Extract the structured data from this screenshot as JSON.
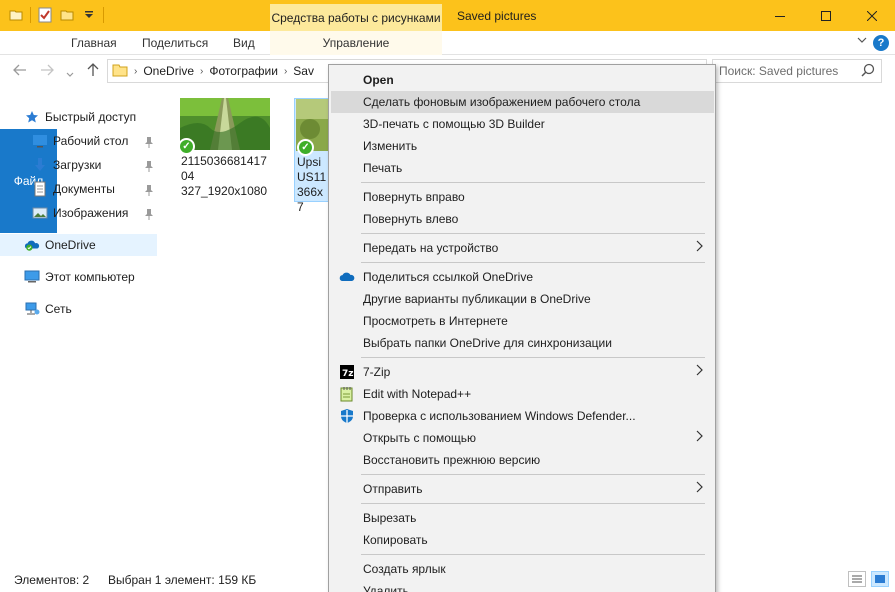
{
  "titlebar": {
    "context_tab_group": "Средства работы с рисунками",
    "window_title": "Saved pictures",
    "minimize": "—",
    "maximize": "☐",
    "close": "✕"
  },
  "ribbon": {
    "tabs": [
      "Файл",
      "Главная",
      "Поделиться",
      "Вид",
      "Управление"
    ],
    "help": "?"
  },
  "address": {
    "crumbs": [
      "OneDrive",
      "Фотографии",
      "Sav"
    ],
    "search_placeholder": "Поиск: Saved pictures"
  },
  "sidebar": {
    "items": [
      {
        "label": "Быстрый доступ",
        "icon": "star-icon"
      },
      {
        "label": "Рабочий стол",
        "icon": "desktop-icon",
        "pinned": true
      },
      {
        "label": "Загрузки",
        "icon": "download-icon",
        "pinned": true
      },
      {
        "label": "Документы",
        "icon": "document-icon",
        "pinned": true
      },
      {
        "label": "Изображения",
        "icon": "pictures-icon",
        "pinned": true
      },
      {
        "label": "OneDrive",
        "icon": "onedrive-icon",
        "selected": true
      },
      {
        "label": "Этот компьютер",
        "icon": "computer-icon"
      },
      {
        "label": "Сеть",
        "icon": "network-icon"
      }
    ]
  },
  "files": [
    {
      "name": "211503668141704327_1920x1080",
      "line1": "211503668141704",
      "line2": "327_1920x1080",
      "synced": true
    },
    {
      "name": "Upsi US11 366x7",
      "line1": "Upsi",
      "line2": "US11",
      "line3": "366x7",
      "synced": true,
      "selected": true
    }
  ],
  "context_menu": {
    "items": [
      {
        "label": "Open",
        "bold": true
      },
      {
        "label": "Сделать фоновым изображением рабочего стола",
        "hover": true
      },
      {
        "label": "3D-печать с помощью 3D Builder"
      },
      {
        "label": "Изменить"
      },
      {
        "label": "Печать"
      },
      {
        "label": "Повернуть вправо"
      },
      {
        "label": "Повернуть влево"
      },
      {
        "label": "Передать на устройство",
        "submenu": true
      },
      {
        "label": "Поделиться ссылкой OneDrive",
        "icon": "onedrive-icon"
      },
      {
        "label": "Другие варианты публикации в OneDrive"
      },
      {
        "label": "Просмотреть в Интернете"
      },
      {
        "label": "Выбрать папки OneDrive для синхронизации"
      },
      {
        "label": "7-Zip",
        "icon": "7zip-icon",
        "submenu": true
      },
      {
        "label": "Edit with Notepad++",
        "icon": "notepadpp-icon"
      },
      {
        "label": "Проверка с использованием Windows Defender...",
        "icon": "defender-icon"
      },
      {
        "label": "Открыть с помощью",
        "submenu": true
      },
      {
        "label": "Восстановить прежнюю версию"
      },
      {
        "label": "Отправить",
        "submenu": true
      },
      {
        "label": "Вырезать"
      },
      {
        "label": "Копировать"
      },
      {
        "label": "Создать ярлык"
      },
      {
        "label": "Удалить"
      }
    ]
  },
  "status": {
    "count": "Элементов: 2",
    "selection": "Выбран 1 элемент: 159 КБ"
  },
  "colors": {
    "titlebar": "#fcc21b",
    "file_tab": "#1979ca",
    "selection": "#cce8ff",
    "sync_check": "#3fae29"
  }
}
